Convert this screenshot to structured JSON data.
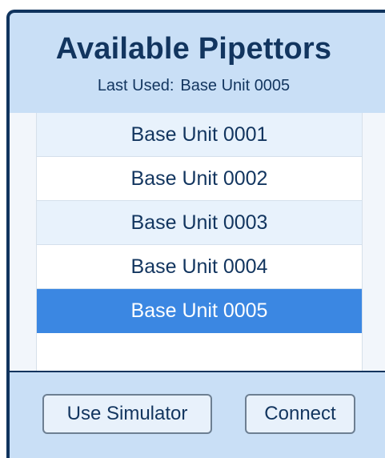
{
  "header": {
    "title": "Available Pipettors",
    "last_used_label": "Last Used:",
    "last_used_value": "Base Unit 0005"
  },
  "list": {
    "items": [
      {
        "label": "Base Unit 0001",
        "selected": false
      },
      {
        "label": "Base Unit 0002",
        "selected": false
      },
      {
        "label": "Base Unit 0003",
        "selected": false
      },
      {
        "label": "Base Unit 0004",
        "selected": false
      },
      {
        "label": "Base Unit 0005",
        "selected": true
      }
    ]
  },
  "footer": {
    "simulator_label": "Use Simulator",
    "connect_label": "Connect"
  },
  "colors": {
    "navy": "#12355f",
    "panel": "#c9dff6",
    "row_alt": "#e8f2fc",
    "selected": "#3b87e2"
  }
}
